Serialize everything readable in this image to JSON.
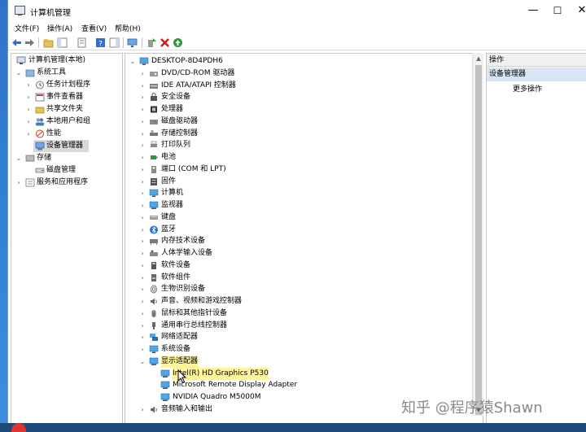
{
  "window": {
    "title": "计算机管理",
    "controls": {
      "minimize": "—",
      "maximize": "☐",
      "close": "✕"
    }
  },
  "menu": [
    "文件(F)",
    "操作(A)",
    "查看(V)",
    "帮助(H)"
  ],
  "left_tree": [
    {
      "label": "计算机管理(本地)",
      "level": 0,
      "expander": ""
    },
    {
      "label": "系统工具",
      "level": 1,
      "expander": "⌄"
    },
    {
      "label": "任务计划程序",
      "level": 2,
      "expander": "›"
    },
    {
      "label": "事件查看器",
      "level": 2,
      "expander": "›"
    },
    {
      "label": "共享文件夹",
      "level": 2,
      "expander": "›"
    },
    {
      "label": "本地用户和组",
      "level": 2,
      "expander": "›"
    },
    {
      "label": "性能",
      "level": 2,
      "expander": "›"
    },
    {
      "label": "设备管理器",
      "level": 2,
      "expander": "",
      "selected": true
    },
    {
      "label": "存储",
      "level": 1,
      "expander": "⌄"
    },
    {
      "label": "磁盘管理",
      "level": 2,
      "expander": ""
    },
    {
      "label": "服务和应用程序",
      "level": 1,
      "expander": "›"
    }
  ],
  "device_tree": {
    "root": "DESKTOP-8D4PDH6",
    "categories": [
      {
        "label": "DVD/CD-ROM 驱动器",
        "icon": "dvd-drive-icon"
      },
      {
        "label": "IDE ATA/ATAPI 控制器",
        "icon": "ide-controller-icon"
      },
      {
        "label": "安全设备",
        "icon": "security-device-icon"
      },
      {
        "label": "处理器",
        "icon": "processor-icon"
      },
      {
        "label": "磁盘驱动器",
        "icon": "disk-drive-icon"
      },
      {
        "label": "存储控制器",
        "icon": "storage-controller-icon"
      },
      {
        "label": "打印队列",
        "icon": "printer-icon"
      },
      {
        "label": "电池",
        "icon": "battery-icon"
      },
      {
        "label": "端口 (COM 和 LPT)",
        "icon": "port-icon"
      },
      {
        "label": "固件",
        "icon": "firmware-icon"
      },
      {
        "label": "计算机",
        "icon": "computer-icon"
      },
      {
        "label": "监视器",
        "icon": "monitor-icon"
      },
      {
        "label": "键盘",
        "icon": "keyboard-icon"
      },
      {
        "label": "蓝牙",
        "icon": "bluetooth-icon"
      },
      {
        "label": "内存技术设备",
        "icon": "memory-device-icon"
      },
      {
        "label": "人体学输入设备",
        "icon": "hid-icon"
      },
      {
        "label": "软件设备",
        "icon": "software-device-icon"
      },
      {
        "label": "软件组件",
        "icon": "software-component-icon"
      },
      {
        "label": "生物识别设备",
        "icon": "biometric-icon"
      },
      {
        "label": "声音、视频和游戏控制器",
        "icon": "sound-icon"
      },
      {
        "label": "鼠标和其他指针设备",
        "icon": "mouse-icon"
      },
      {
        "label": "通用串行总线控制器",
        "icon": "usb-icon"
      },
      {
        "label": "网络适配器",
        "icon": "network-adapter-icon"
      },
      {
        "label": "系统设备",
        "icon": "system-device-icon"
      },
      {
        "label": "显示适配器",
        "icon": "display-adapter-icon",
        "expanded": true,
        "highlighted": true
      }
    ],
    "display_adapters": [
      {
        "label": "Intel(R) HD Graphics P530",
        "highlighted": true
      },
      {
        "label": "Microsoft Remote Display Adapter"
      },
      {
        "label": "NVIDIA Quadro M5000M"
      }
    ],
    "after": [
      {
        "label": "音频输入和输出",
        "icon": "audio-io-icon"
      }
    ]
  },
  "actions": {
    "header": "操作",
    "section": "设备管理器",
    "more": "更多操作"
  },
  "watermark": "知乎 @程序猿Shawn"
}
